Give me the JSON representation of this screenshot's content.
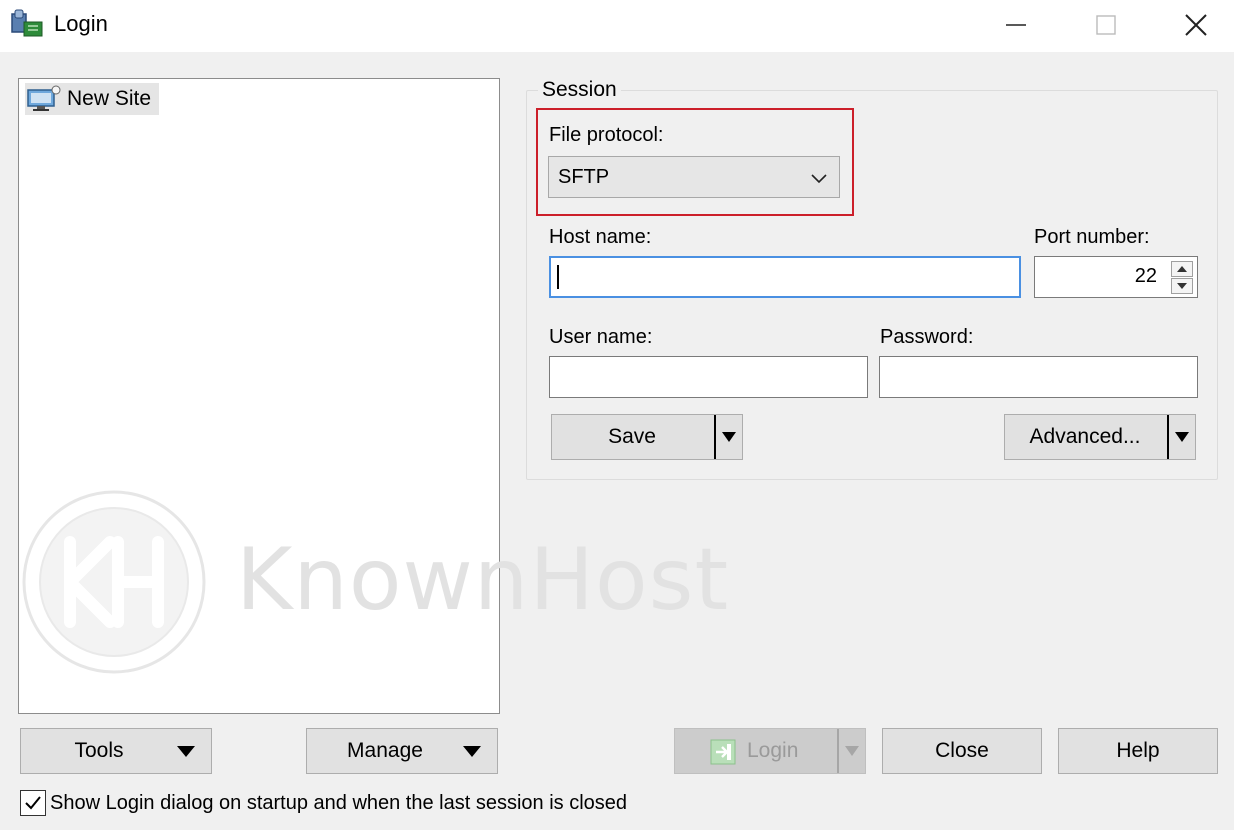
{
  "window": {
    "title": "Login",
    "controls": [
      "minimize",
      "maximize",
      "close"
    ]
  },
  "site_tree": {
    "items": [
      {
        "label": "New Site",
        "icon": "computer-icon",
        "selected": true
      }
    ]
  },
  "watermark": {
    "text": "KnownHost",
    "logo_text": "KH"
  },
  "session": {
    "group_label": "Session",
    "file_protocol": {
      "label": "File protocol:",
      "value": "SFTP",
      "highlight_color": "#cc1f2a"
    },
    "host_name": {
      "label": "Host name:",
      "value": ""
    },
    "port_number": {
      "label": "Port number:",
      "value": "22"
    },
    "user_name": {
      "label": "User name:",
      "value": ""
    },
    "password": {
      "label": "Password:",
      "value": ""
    },
    "save_label": "Save",
    "advanced_label": "Advanced..."
  },
  "footer": {
    "tools_label": "Tools",
    "manage_label": "Manage",
    "login_label": "Login",
    "login_enabled": false,
    "close_label": "Close",
    "help_label": "Help",
    "show_login_checkbox": {
      "label": "Show Login dialog on startup and when the last session is closed",
      "checked": true
    }
  }
}
